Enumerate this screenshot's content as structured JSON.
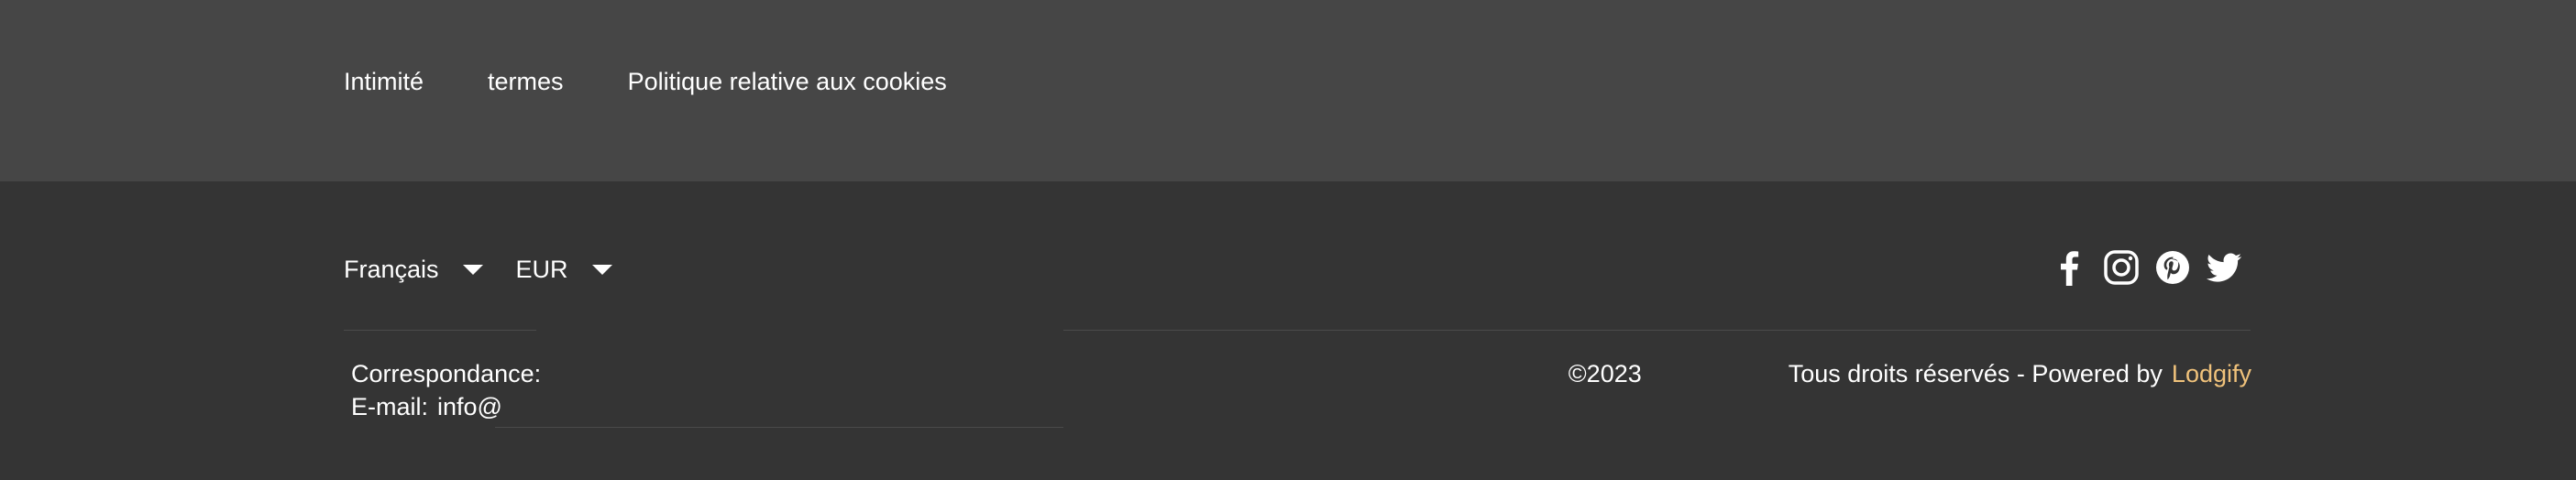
{
  "footer_links": {
    "privacy": "Intimité",
    "terms": "termes",
    "cookies": "Politique relative aux cookies"
  },
  "selectors": {
    "language": "Français",
    "currency": "EUR"
  },
  "social": {
    "icons": [
      "facebook-icon",
      "instagram-icon",
      "pinterest-icon",
      "twitter-icon"
    ]
  },
  "contact": {
    "mail_label": "Correspondance:",
    "email_label": "E-mail:",
    "email_value": "info@"
  },
  "copyright": {
    "year": "©2023",
    "rights": "Tous droits réservés - Powered by",
    "brand": "Lodgify",
    "brand_color": "#f0c27b"
  }
}
